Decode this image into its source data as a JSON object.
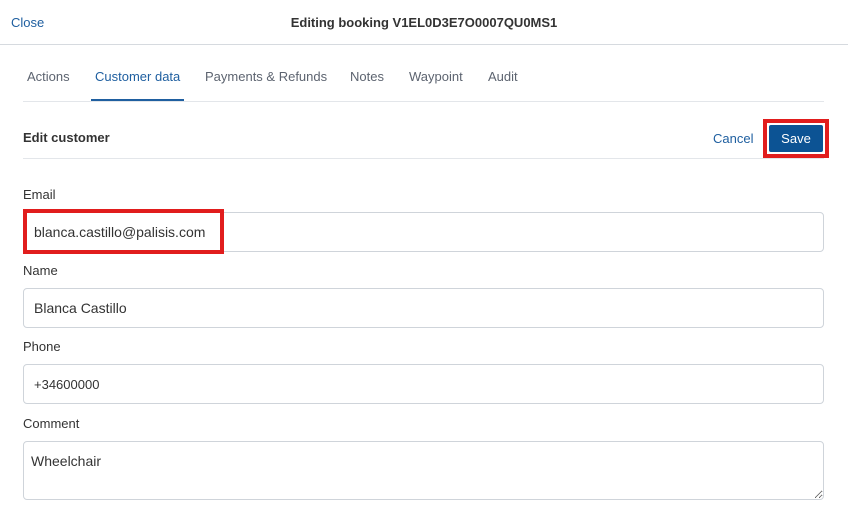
{
  "header": {
    "close_label": "Close",
    "title": "Editing booking V1EL0D3E7O0007QU0MS1"
  },
  "tabs": [
    {
      "label": "Actions",
      "active": false
    },
    {
      "label": "Customer data",
      "active": true
    },
    {
      "label": "Payments & Refunds",
      "active": false
    },
    {
      "label": "Notes",
      "active": false
    },
    {
      "label": "Waypoint",
      "active": false
    },
    {
      "label": "Audit",
      "active": false
    }
  ],
  "section": {
    "title": "Edit customer",
    "cancel_label": "Cancel",
    "save_label": "Save"
  },
  "form": {
    "email": {
      "label": "Email",
      "value": "blanca.castillo@palisis.com"
    },
    "name": {
      "label": "Name",
      "value": "Blanca Castillo"
    },
    "phone": {
      "label": "Phone",
      "value": "+34600000"
    },
    "comment": {
      "label": "Comment",
      "value": "Wheelchair"
    }
  },
  "colors": {
    "accent": "#1f5fa0",
    "primary_button": "#0c5394",
    "highlight": "#e11d1d"
  }
}
